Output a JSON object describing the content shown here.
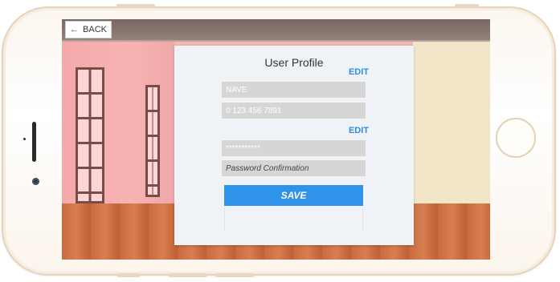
{
  "topbar": {
    "back_label": "BACK",
    "back_icon": "left-arrow-icon"
  },
  "profile": {
    "title": "User Profile",
    "edit_label_1": "EDIT",
    "edit_label_2": "EDIT",
    "name_value": "NAVE",
    "phone_value": "0 123 456 7891",
    "password_value": "***********",
    "password_confirm_placeholder": "Password Confirmation",
    "save_label": "SAVE"
  },
  "colors": {
    "accent": "#2f93ea",
    "edit_link": "#2f8de2",
    "panel": "#eff3f7",
    "field": "#d6d6d6"
  }
}
